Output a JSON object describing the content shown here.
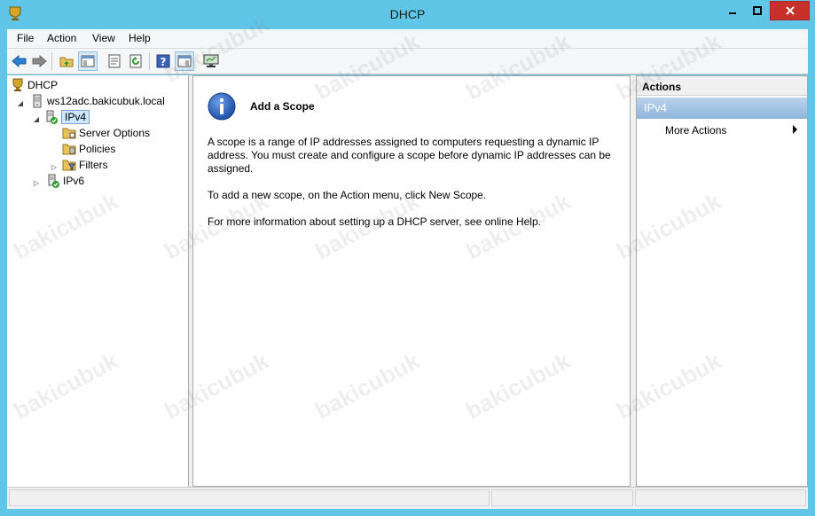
{
  "window": {
    "title": "DHCP"
  },
  "menu": {
    "items": [
      "File",
      "Action",
      "View",
      "Help"
    ]
  },
  "toolbar": {
    "buttons": [
      "back-arrow-icon",
      "forward-arrow-icon",
      "up-folder-icon",
      "show-tree-icon",
      "properties-icon",
      "refresh-icon",
      "help-icon",
      "show-action-pane-icon",
      "monitor-icon"
    ]
  },
  "tree": {
    "root": "DHCP",
    "server": "ws12adc.bakicubuk.local",
    "ipv4": "IPv4",
    "server_options": "Server Options",
    "policies": "Policies",
    "filters": "Filters",
    "ipv6": "IPv6"
  },
  "content": {
    "heading": "Add a Scope",
    "para1_line1": "A scope is a range of IP addresses assigned to computers requesting a dynamic IP",
    "para1_line2": "address. You must create and configure a scope before dynamic IP addresses can be",
    "para1_line3": "assigned.",
    "para2": "To add a new scope, on the Action menu, click New Scope.",
    "para3": "For more information about setting up a DHCP server, see online Help."
  },
  "actions": {
    "header": "Actions",
    "group": "IPv4",
    "more": "More Actions"
  },
  "watermark": "bakicubuk",
  "colors": {
    "titlebar": "#5fc6e8",
    "close": "#c7302b",
    "selection": "#cce8ff",
    "action_group": "#8eb5dc"
  }
}
